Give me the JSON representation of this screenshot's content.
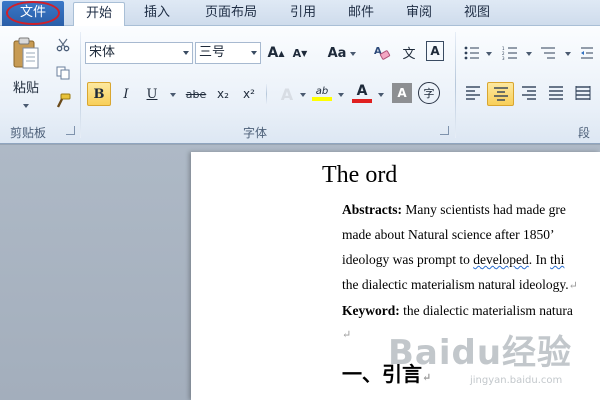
{
  "tabs": {
    "file": "文件",
    "home": "开始",
    "insert": "插入",
    "page_layout": "页面布局",
    "references": "引用",
    "mailings": "邮件",
    "review": "审阅",
    "view": "视图"
  },
  "ribbon": {
    "clipboard": {
      "paste_label": "粘贴",
      "group_label": "剪贴板"
    },
    "font": {
      "font_name": "宋体",
      "font_size": "三号",
      "grow_label": "A",
      "shrink_label": "A",
      "change_case_label": "Aa",
      "phonetic_label": "文",
      "enclose_label": "A",
      "bold_label": "B",
      "italic_label": "I",
      "underline_label": "U",
      "strikethrough_label": "abe",
      "subscript_label": "x₂",
      "superscript_label": "x²",
      "text_effect_label": "A",
      "highlight_label": "ab",
      "font_color_label": "A",
      "char_shading_label": "A",
      "enclose_char_label": "字",
      "group_label": "字体"
    },
    "paragraph": {
      "group_label": "段"
    }
  },
  "document": {
    "title": "The ord",
    "abstract_label": "Abstracts:",
    "line1": "Many scientists had made gre",
    "line2": "made about Natural science after 1850’",
    "line3_a": "ideology was prompt to ",
    "line3_b": "developed",
    "line3_c": ". In ",
    "line3_d": "thi",
    "line4": "the dialectic materialism natural ideology.",
    "keyword_label": "Keyword:",
    "keyword_text": "the dialectic materialism natura",
    "heading": "一、引言",
    "para_mark": "↵"
  },
  "watermark": {
    "brand": "Baidu经验",
    "url": "jingyan.baidu.com"
  },
  "colors": {
    "file_tab": "#2a5fa8",
    "highlight_yellow": "#ffff00",
    "font_color_red": "#e02020",
    "active_button": "#f8cf59"
  }
}
